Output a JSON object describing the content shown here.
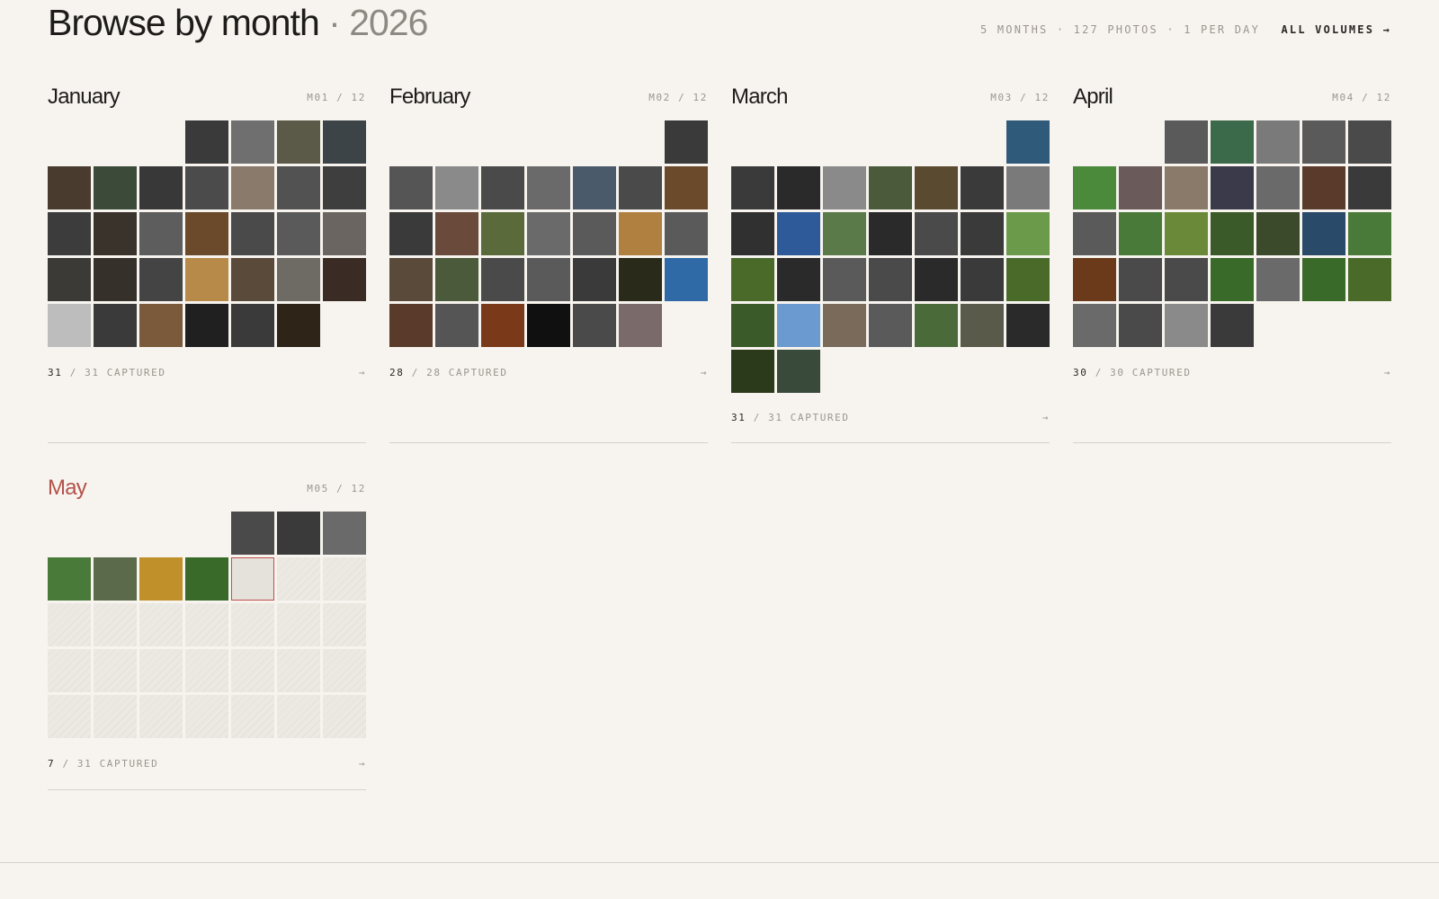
{
  "header": {
    "title": "Browse by month",
    "separator": "·",
    "year": "2026",
    "stats": "5 MONTHS · 127 PHOTOS · 1 PER DAY",
    "all_volumes": "ALL VOLUMES →"
  },
  "months": [
    {
      "name": "January",
      "code": "M01 / 12",
      "lead_blanks": 3,
      "days": 31,
      "captured": 31,
      "today": null,
      "captured_label": "31",
      "total_label": "/ 31 CAPTURED",
      "arrow": "→",
      "tones": [
        "#3a3a3a",
        "#6f6f6f",
        "#5b5a48",
        "#3d4448",
        "#4a3b2f",
        "#3c4a3a",
        "#383838",
        "#4b4b4b",
        "#8a7a6c",
        "#525252",
        "#3e3e3e",
        "#3c3c3c",
        "#3a332c",
        "#5d5d5d",
        "#6a4a2a",
        "#4a4a4a",
        "#5a5a5a",
        "#6a6560",
        "#3b3a36",
        "#35302a",
        "#444444",
        "#b78a4a",
        "#5a4a3a",
        "#6e6a64",
        "#3a2b24",
        "#bdbdbd",
        "#3a3a3a",
        "#7a5a3a",
        "#202020",
        "#3a3a3a",
        "#2e2418"
      ]
    },
    {
      "name": "February",
      "code": "M02 / 12",
      "lead_blanks": 6,
      "days": 28,
      "captured": 28,
      "today": null,
      "captured_label": "28",
      "total_label": "/ 28 CAPTURED",
      "arrow": "→",
      "tones": [
        "#3a3a3a",
        "#555555",
        "#8a8a8a",
        "#4a4a4a",
        "#6a6a6a",
        "#4a5a6a",
        "#4a4a4a",
        "#6a4a2a",
        "#3a3a3a",
        "#6a4a3a",
        "#5a6a3a",
        "#6a6a6a",
        "#5a5a5a",
        "#b08040",
        "#5a5a5a",
        "#5a4a3a",
        "#4a5a3a",
        "#4a4a4a",
        "#5a5a5a",
        "#3a3a3a",
        "#2a2a1a",
        "#2f6aa6",
        "#5a3a2a",
        "#555555",
        "#7a3a1a",
        "#101010",
        "#4a4a4a",
        "#7a6a6a"
      ]
    },
    {
      "name": "March",
      "code": "M03 / 12",
      "lead_blanks": 6,
      "days": 31,
      "captured": 31,
      "today": null,
      "captured_label": "31",
      "total_label": "/ 31 CAPTURED",
      "arrow": "→",
      "tones": [
        "#2f5a7a",
        "#3a3a3a",
        "#2a2a2a",
        "#8a8a8a",
        "#4a5a3a",
        "#5a4a30",
        "#3a3a3a",
        "#7a7a7a",
        "#303030",
        "#2f5a9a",
        "#5a7a4a",
        "#2a2a2a",
        "#4a4a4a",
        "#3a3a3a",
        "#6a9a4a",
        "#4a6a2a",
        "#2a2a2a",
        "#5a5a5a",
        "#4a4a4a",
        "#2a2a2a",
        "#3a3a3a",
        "#4a6a2a",
        "#3a5a2a",
        "#6a9ad0",
        "#7a6a5a",
        "#5a5a5a",
        "#4a6a3a",
        "#5a5a4a",
        "#2a2a2a",
        "#2a3a1a",
        "#3a4a3a"
      ]
    },
    {
      "name": "April",
      "code": "M04 / 12",
      "lead_blanks": 2,
      "days": 30,
      "captured": 30,
      "today": null,
      "captured_label": "30",
      "total_label": "/ 30 CAPTURED",
      "arrow": "→",
      "tones": [
        "#5a5a5a",
        "#3a6a4a",
        "#7a7a7a",
        "#5a5a5a",
        "#4a4a4a",
        "#4a8a3a",
        "#6a5a5a",
        "#8a7a6a",
        "#3a3a4a",
        "#6a6a6a",
        "#5a3a2a",
        "#3a3a3a",
        "#5a5a5a",
        "#4a7a3a",
        "#6a8a3a",
        "#3a5a2a",
        "#3a4a2a",
        "#2a4a6a",
        "#4a7a3a",
        "#6a3a1a",
        "#4a4a4a",
        "#4a4a4a",
        "#3a6a2a",
        "#6a6a6a",
        "#3a6a2a",
        "#4a6a2a",
        "#6a6a6a",
        "#4a4a4a",
        "#8a8a8a",
        "#3a3a3a"
      ]
    },
    {
      "name": "May",
      "code": "M05 / 12",
      "lead_blanks": 4,
      "days": 31,
      "captured": 7,
      "today": 8,
      "captured_label": "7",
      "total_label": "/ 31 CAPTURED",
      "arrow": "→",
      "tones": [
        "#4a4a4a",
        "#3a3a3a",
        "#6a6a6a",
        "#4a7a3a",
        "#5a6a4a",
        "#c0902a",
        "#3a6a2a"
      ]
    }
  ]
}
